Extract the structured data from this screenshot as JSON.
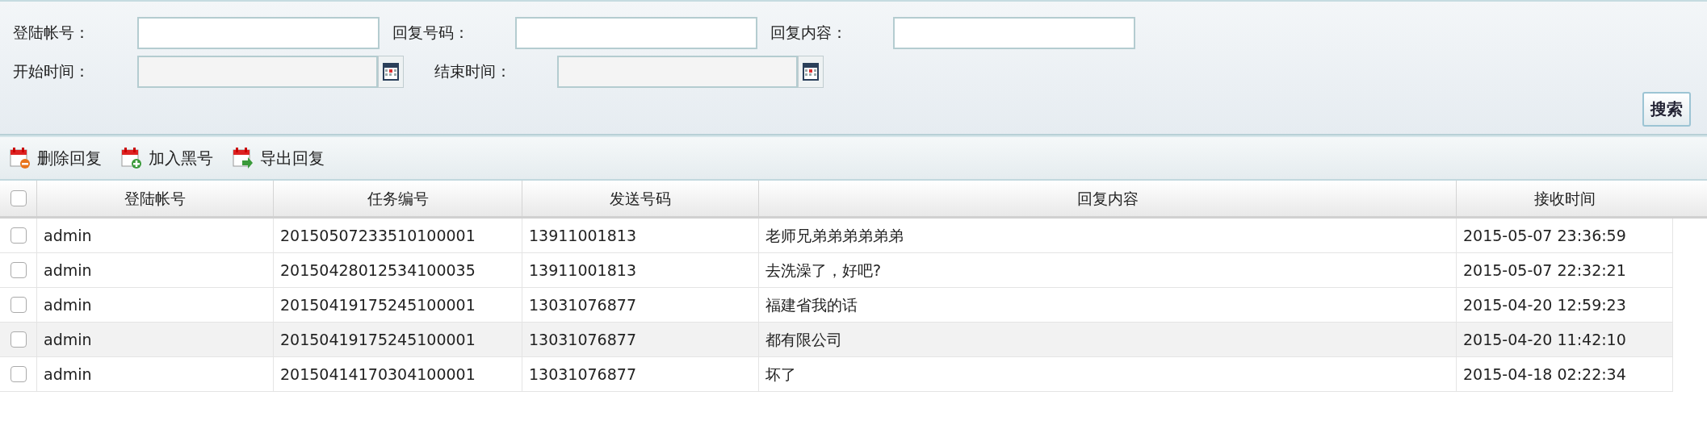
{
  "search": {
    "fields": [
      {
        "label": "登陆帐号：",
        "kind": "text"
      },
      {
        "label": "回复号码：",
        "kind": "text"
      },
      {
        "label": "回复内容：",
        "kind": "text"
      },
      {
        "label": "开始时间：",
        "kind": "date"
      },
      {
        "label": "结束时间：",
        "kind": "date"
      }
    ],
    "button": "搜索"
  },
  "toolbar": [
    {
      "label": "删除回复",
      "kind": "delete"
    },
    {
      "label": "加入黑号",
      "kind": "add"
    },
    {
      "label": "导出回复",
      "kind": "export"
    }
  ],
  "table": {
    "select_all": {
      "checked": false
    },
    "columns": [
      "登陆帐号",
      "任务编号",
      "发送号码",
      "回复内容",
      "接收时间"
    ],
    "rows": [
      {
        "checked": false,
        "hovered": false,
        "cells": [
          "admin",
          "20150507233510100001",
          "13911001813",
          "老师兄弟弟弟弟弟弟",
          "2015-05-07 23:36:59"
        ]
      },
      {
        "checked": false,
        "hovered": false,
        "cells": [
          "admin",
          "20150428012534100035",
          "13911001813",
          "去洗澡了，好吧?",
          "2015-05-07 22:32:21"
        ]
      },
      {
        "checked": false,
        "hovered": false,
        "cells": [
          "admin",
          "20150419175245100001",
          "13031076877",
          "福建省我的话",
          "2015-04-20 12:59:23"
        ]
      },
      {
        "checked": false,
        "hovered": true,
        "cells": [
          "admin",
          "20150419175245100001",
          "13031076877",
          "都有限公司",
          "2015-04-20 11:42:10"
        ]
      },
      {
        "checked": false,
        "hovered": false,
        "cells": [
          "admin",
          "20150414170304100001",
          "13031076877",
          "坏了",
          "2015-04-18 02:22:34"
        ]
      }
    ]
  }
}
